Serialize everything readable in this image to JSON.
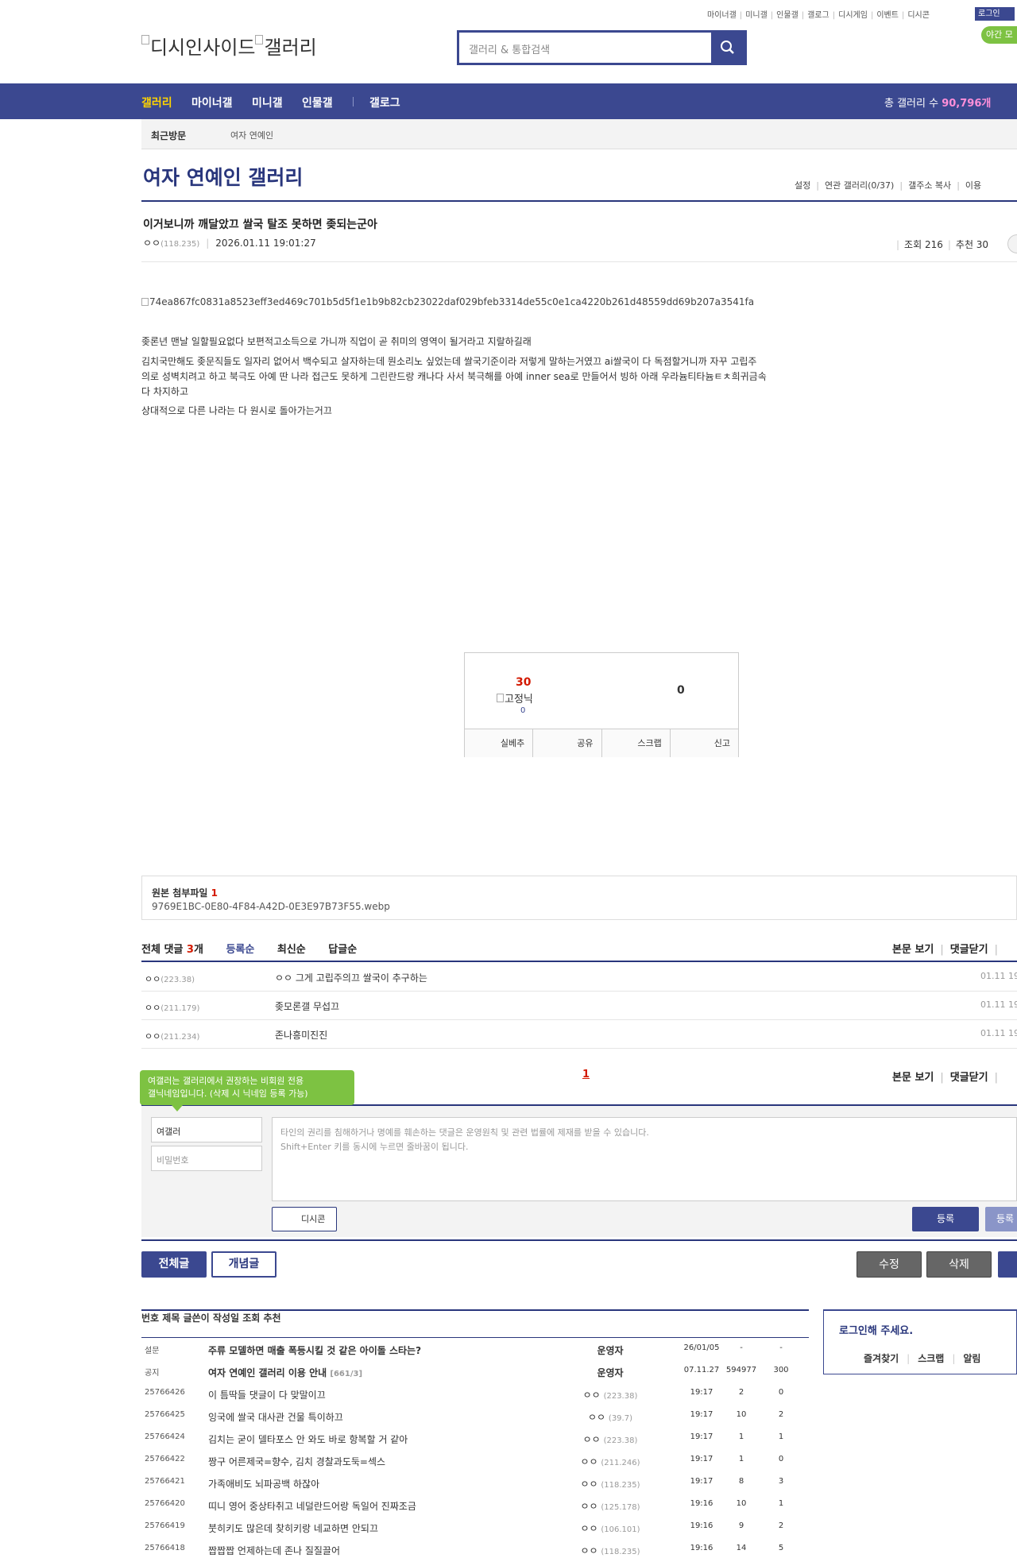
{
  "util_links": [
    "마이너갤",
    "미니갤",
    "인물갤",
    "갤로그",
    "디시게임",
    "이벤트",
    "디시콘"
  ],
  "login_label": "로그인",
  "night_label": "야간 모",
  "logo_text": [
    "디시인사이드",
    "갤러리"
  ],
  "search_placeholder": "갤러리 & 통합검색",
  "gnb": {
    "items": [
      "갤러리",
      "마이너갤",
      "미니갤",
      "인물갤",
      "갤로그"
    ],
    "total_label": "총 갤러리 수",
    "total_value": "90,796개"
  },
  "visit": {
    "label": "최근방문",
    "item": "여자 연예인"
  },
  "gallery": {
    "title": "여자 연예인 갤러리",
    "links": [
      "설정",
      "연관 갤러리(0/37)",
      "갤주소 복사",
      "이용"
    ]
  },
  "post": {
    "title": "이거보니까 깨달았끄 쌀국 탈조 못하면 좆되는군아",
    "writer": "ㅇㅇ",
    "ip": "(118.235)",
    "date": "2026.01.11 19:01:27",
    "views_label": "조회 216",
    "rec_label": "추천 30",
    "image_alt": "74ea867fc0831a8523eff3ed469c701b5d5f1e1b9b82cb23022daf029bfeb3314de55c0e1ca4220b261d48559dd69b207a3541fa",
    "body": [
      "좆론년 맨날 일할필요없다 보편적고소득으로 가니까 직업이 곧 취미의 영역이 될거라고 지랄하길래",
      "김치국만해도 좆문직들도 일자리 없어서 백수되고 살자하는데 뭔소리노 싶었는데 쌀국기준이라 저렇게 말하는거였끄 ai쌀국이 다 독점할거니까 자꾸 고립주",
      "의로 성벽치려고 하고 북극도 아예 딴 나라 접근도 못하게 그린란드랑 캐나다 사서 북극해를 아예 inner sea로 만들어서 빙하 아래 우라늄티타늄ㅌㅊ희귀금속",
      "다 차지하고",
      "상대적으로 다른 나라는 다 원시로 돌아가는거끄"
    ]
  },
  "recommend": {
    "up_count": "30",
    "fix_label": "고정닉",
    "fix_count": "0",
    "down_count": "0",
    "buttons": [
      "실베추",
      "공유",
      "스크랩",
      "신고"
    ]
  },
  "attachment": {
    "label": "원본 첨부파일",
    "count": "1",
    "file": "9769E1BC-0E80-4F84-A42D-0E3E97B73F55.webp"
  },
  "comments": {
    "label": "전체 댓글",
    "count": "3",
    "unit": "개",
    "tabs": [
      "등록순",
      "최신순",
      "답글순"
    ],
    "right_links": [
      "본문 보기",
      "댓글닫기"
    ],
    "items": [
      {
        "writer": "ㅇㅇ",
        "ip": "(223.38)",
        "text": "ㅇㅇ 그게 고립주의끄 쌀국이 추구하는",
        "date": "01.11 19"
      },
      {
        "writer": "ㅇㅇ",
        "ip": "(211.179)",
        "text": "좆모론갤 무섭끄",
        "date": "01.11 19"
      },
      {
        "writer": "ㅇㅇ",
        "ip": "(211.234)",
        "text": "존나흥미진진",
        "date": "01.11 19"
      }
    ],
    "page": "1"
  },
  "comment_write": {
    "tooltip_line1": "여갤러는 갤러리에서 권장하는 비회원 전용",
    "tooltip_line2": "갤닉네임입니다. (삭제 시 닉네임 등록 가능)",
    "nick_value": "여갤러",
    "pw_placeholder": "비밀번호",
    "textarea_line1": "타인의 권리를 침해하거나 명예를 훼손하는 댓글은 운영원칙 및 관련 법률에 제재를 받을 수 있습니다.",
    "textarea_line2": "Shift+Enter 키를 동시에 누르면 줄바꿈이 됩니다.",
    "dccon_label": "디시콘",
    "submit_label": "등록",
    "submit2_label": "등록"
  },
  "bottom_buttons": {
    "all": "전체글",
    "concept": "개념글",
    "edit": "수정",
    "delete": "삭제"
  },
  "list": {
    "headers": [
      "번호",
      "제목",
      "글쓴이",
      "작성일",
      "조회",
      "추천"
    ],
    "rows": [
      {
        "num": "설문",
        "title": "주류 모델하면 매출 폭등시킬 것 같은 아이돌 스타는?",
        "reply": "",
        "writer": "운영자",
        "ip": "",
        "date": "26/01/05",
        "views": "-",
        "rec": "-",
        "notice": true
      },
      {
        "num": "공지",
        "title": "여자 연예인 갤러리 이용 안내",
        "reply": "[661/3]",
        "writer": "운영자",
        "ip": "",
        "date": "07.11.27",
        "views": "594977",
        "rec": "300",
        "notice": true
      },
      {
        "num": "25766426",
        "title": "이 틈딱들 댓글이 다 맞말이끄",
        "reply": "",
        "writer": "ㅇㅇ",
        "ip": "(223.38)",
        "date": "19:17",
        "views": "2",
        "rec": "0",
        "notice": false
      },
      {
        "num": "25766425",
        "title": "잉국에 쌀국 대사관 건물 특이하끄",
        "reply": "",
        "writer": "ㅇㅇ",
        "ip": "(39.7)",
        "date": "19:17",
        "views": "10",
        "rec": "2",
        "notice": false
      },
      {
        "num": "25766424",
        "title": "김치는 굳이 델타포스 안 와도 바로 항복할 거 같아",
        "reply": "",
        "writer": "ㅇㅇ",
        "ip": "(223.38)",
        "date": "19:17",
        "views": "1",
        "rec": "1",
        "notice": false
      },
      {
        "num": "25766422",
        "title": "짱구 어른제국=향수, 김치 경찰과도둑=섹스",
        "reply": "",
        "writer": "ㅇㅇ",
        "ip": "(211.246)",
        "date": "19:17",
        "views": "1",
        "rec": "0",
        "notice": false
      },
      {
        "num": "25766421",
        "title": "가족애비도 뇌파공백 하잖아",
        "reply": "",
        "writer": "ㅇㅇ",
        "ip": "(118.235)",
        "date": "19:17",
        "views": "8",
        "rec": "3",
        "notice": false
      },
      {
        "num": "25766420",
        "title": "띠니 영어 중상타취고 네덜란드어랑 독일어 진짜조금",
        "reply": "",
        "writer": "ㅇㅇ",
        "ip": "(125.178)",
        "date": "19:16",
        "views": "10",
        "rec": "1",
        "notice": false
      },
      {
        "num": "25766419",
        "title": "붓히키도 많은데 찾히키랑 네교하면 안되끄",
        "reply": "",
        "writer": "ㅇㅇ",
        "ip": "(106.101)",
        "date": "19:16",
        "views": "9",
        "rec": "2",
        "notice": false
      },
      {
        "num": "25766418",
        "title": "짭짭짭 언제하는데 존나 질질끌어",
        "reply": "",
        "writer": "ㅇㅇ",
        "ip": "(118.235)",
        "date": "19:16",
        "views": "14",
        "rec": "5",
        "notice": false
      }
    ]
  },
  "login_box": {
    "title": "로그인해 주세요.",
    "links": [
      "즐겨찾기",
      "스크랩",
      "알림"
    ]
  },
  "colors": {
    "navy": "#3b4890",
    "dark_navy": "#29367c",
    "green": "#7dc242",
    "red": "#d31900"
  }
}
